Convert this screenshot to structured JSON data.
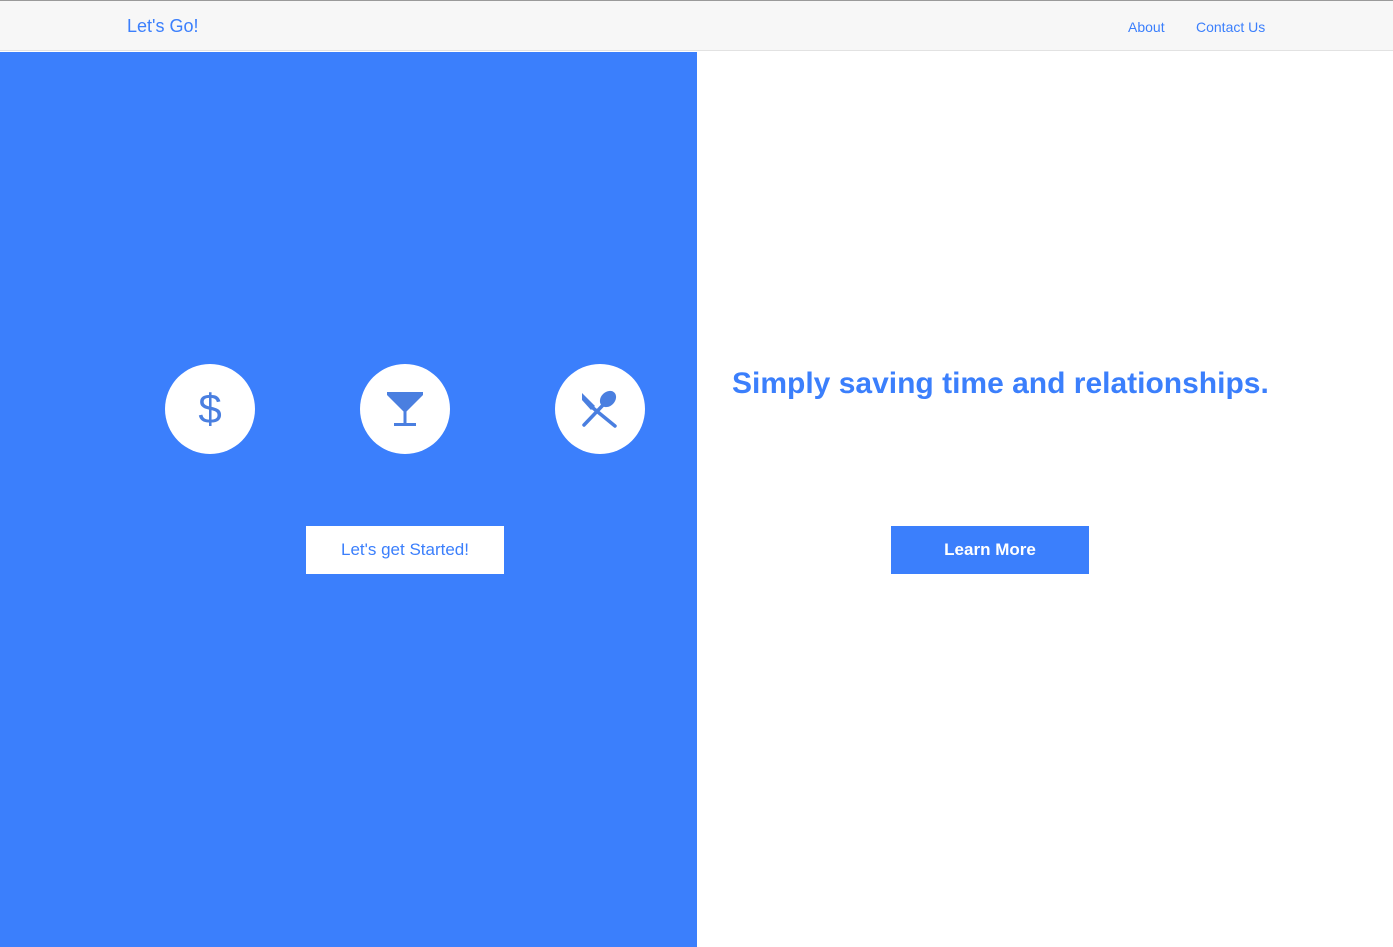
{
  "navbar": {
    "brand": "Let's Go!",
    "links": [
      {
        "label": "About"
      },
      {
        "label": "Contact Us"
      }
    ]
  },
  "hero": {
    "icons": [
      "dollar-icon",
      "cocktail-glass-icon",
      "utensils-icon"
    ],
    "start_button_label": "Let's get Started!"
  },
  "aside": {
    "tagline": "Simply saving time and relationships.",
    "learn_more_label": "Learn More"
  },
  "colors": {
    "accent": "#3b7ffc",
    "icon": "#4a7fe0",
    "navbar_bg": "#f7f7f7",
    "white": "#ffffff"
  }
}
